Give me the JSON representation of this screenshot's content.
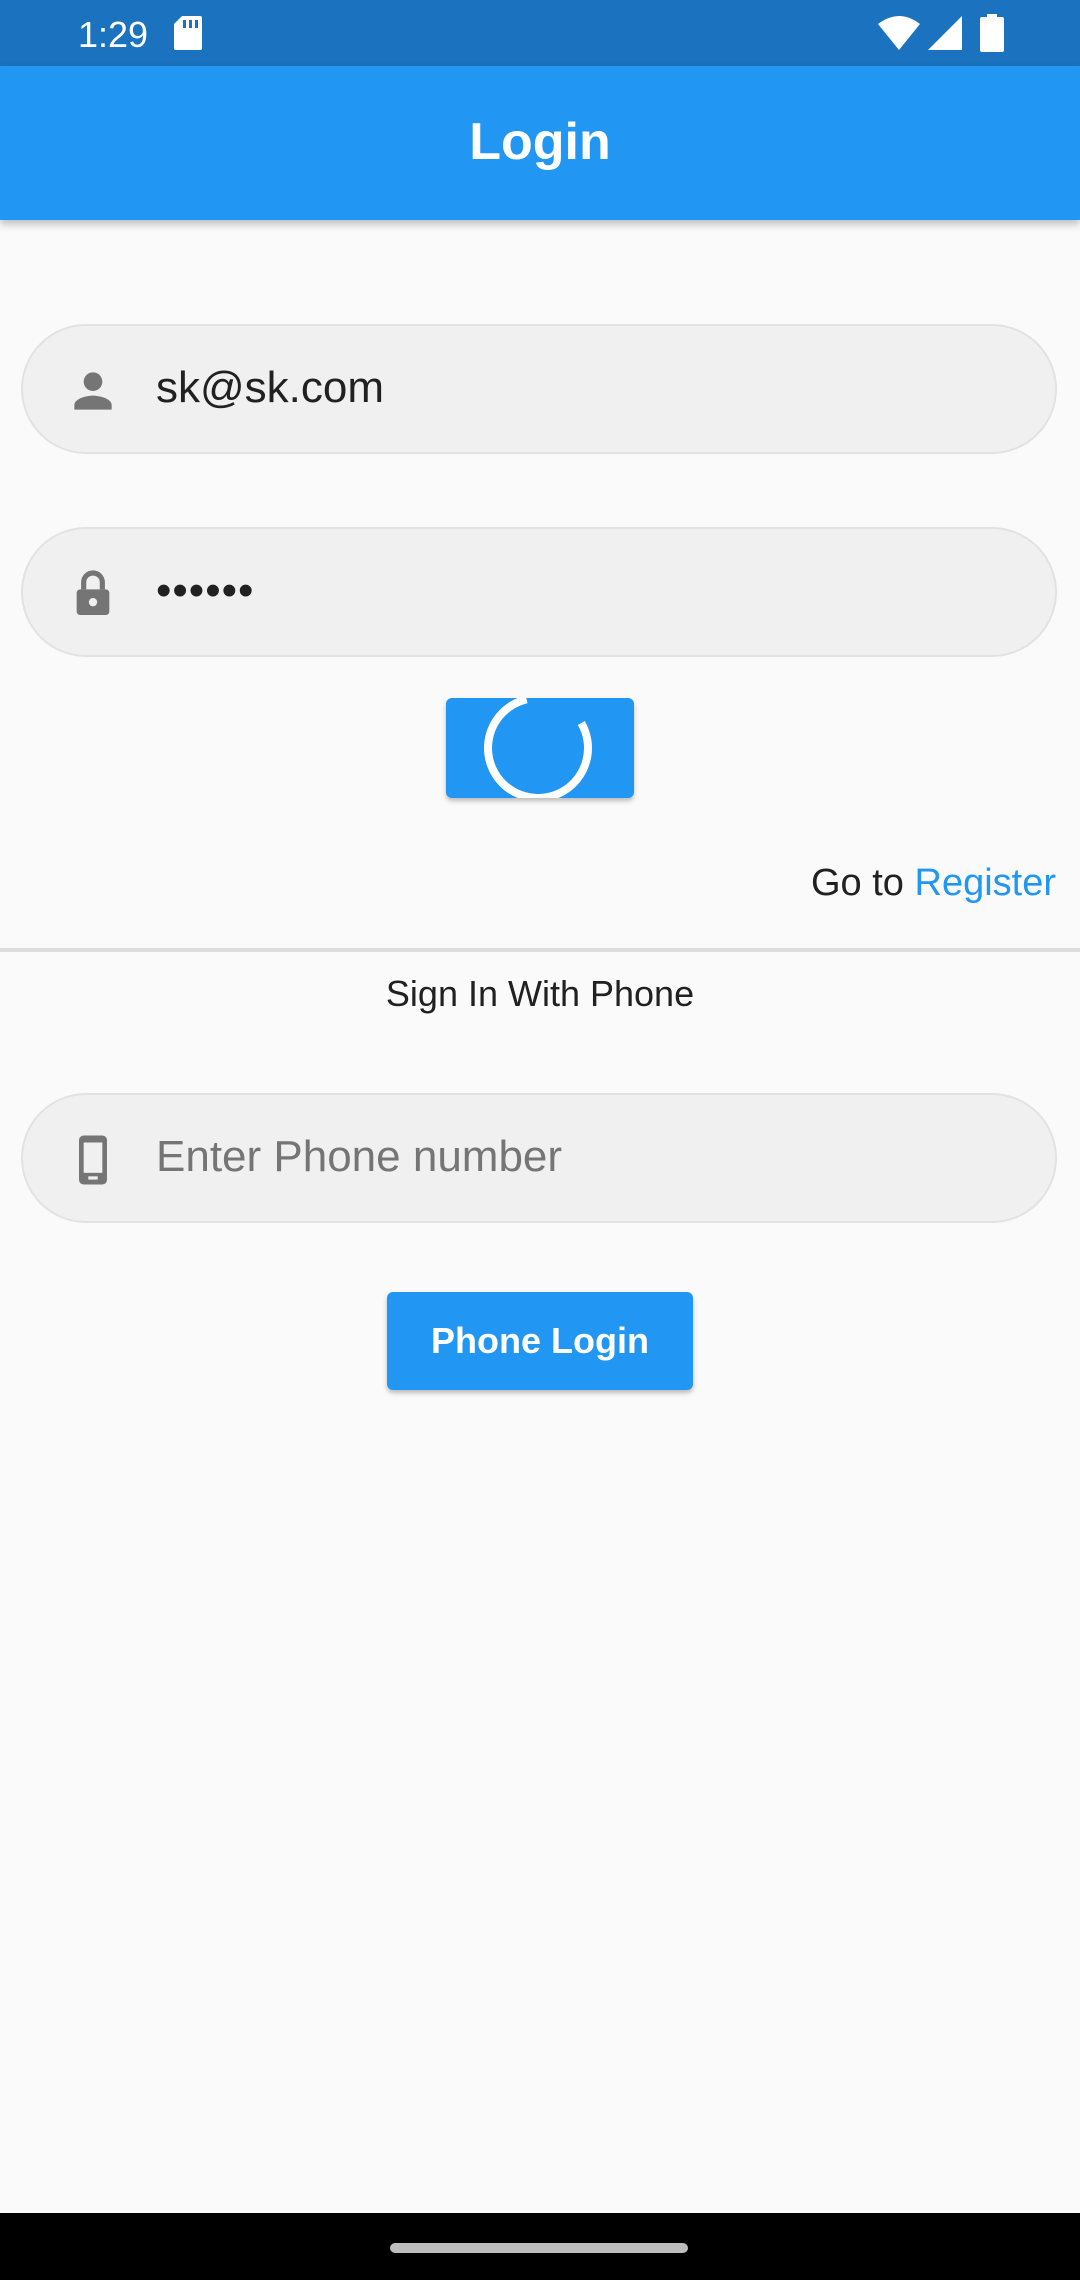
{
  "status_bar": {
    "time": "1:29"
  },
  "app_bar": {
    "title": "Login"
  },
  "email_field": {
    "value": "sk@sk.com",
    "icon": "person-icon"
  },
  "password_field": {
    "value": "••••••",
    "icon": "lock-icon"
  },
  "login_button": {
    "state": "loading"
  },
  "register_prompt": {
    "prefix": "Go to ",
    "link": "Register"
  },
  "phone_section": {
    "label": "Sign In With Phone",
    "input_placeholder": "Enter Phone number",
    "button_label": "Phone Login"
  },
  "colors": {
    "primary": "#2196f3",
    "status_bar": "#1b72bf",
    "background": "#fafafa",
    "field_fill": "#f0f0f0",
    "icon_grey": "#757575"
  }
}
